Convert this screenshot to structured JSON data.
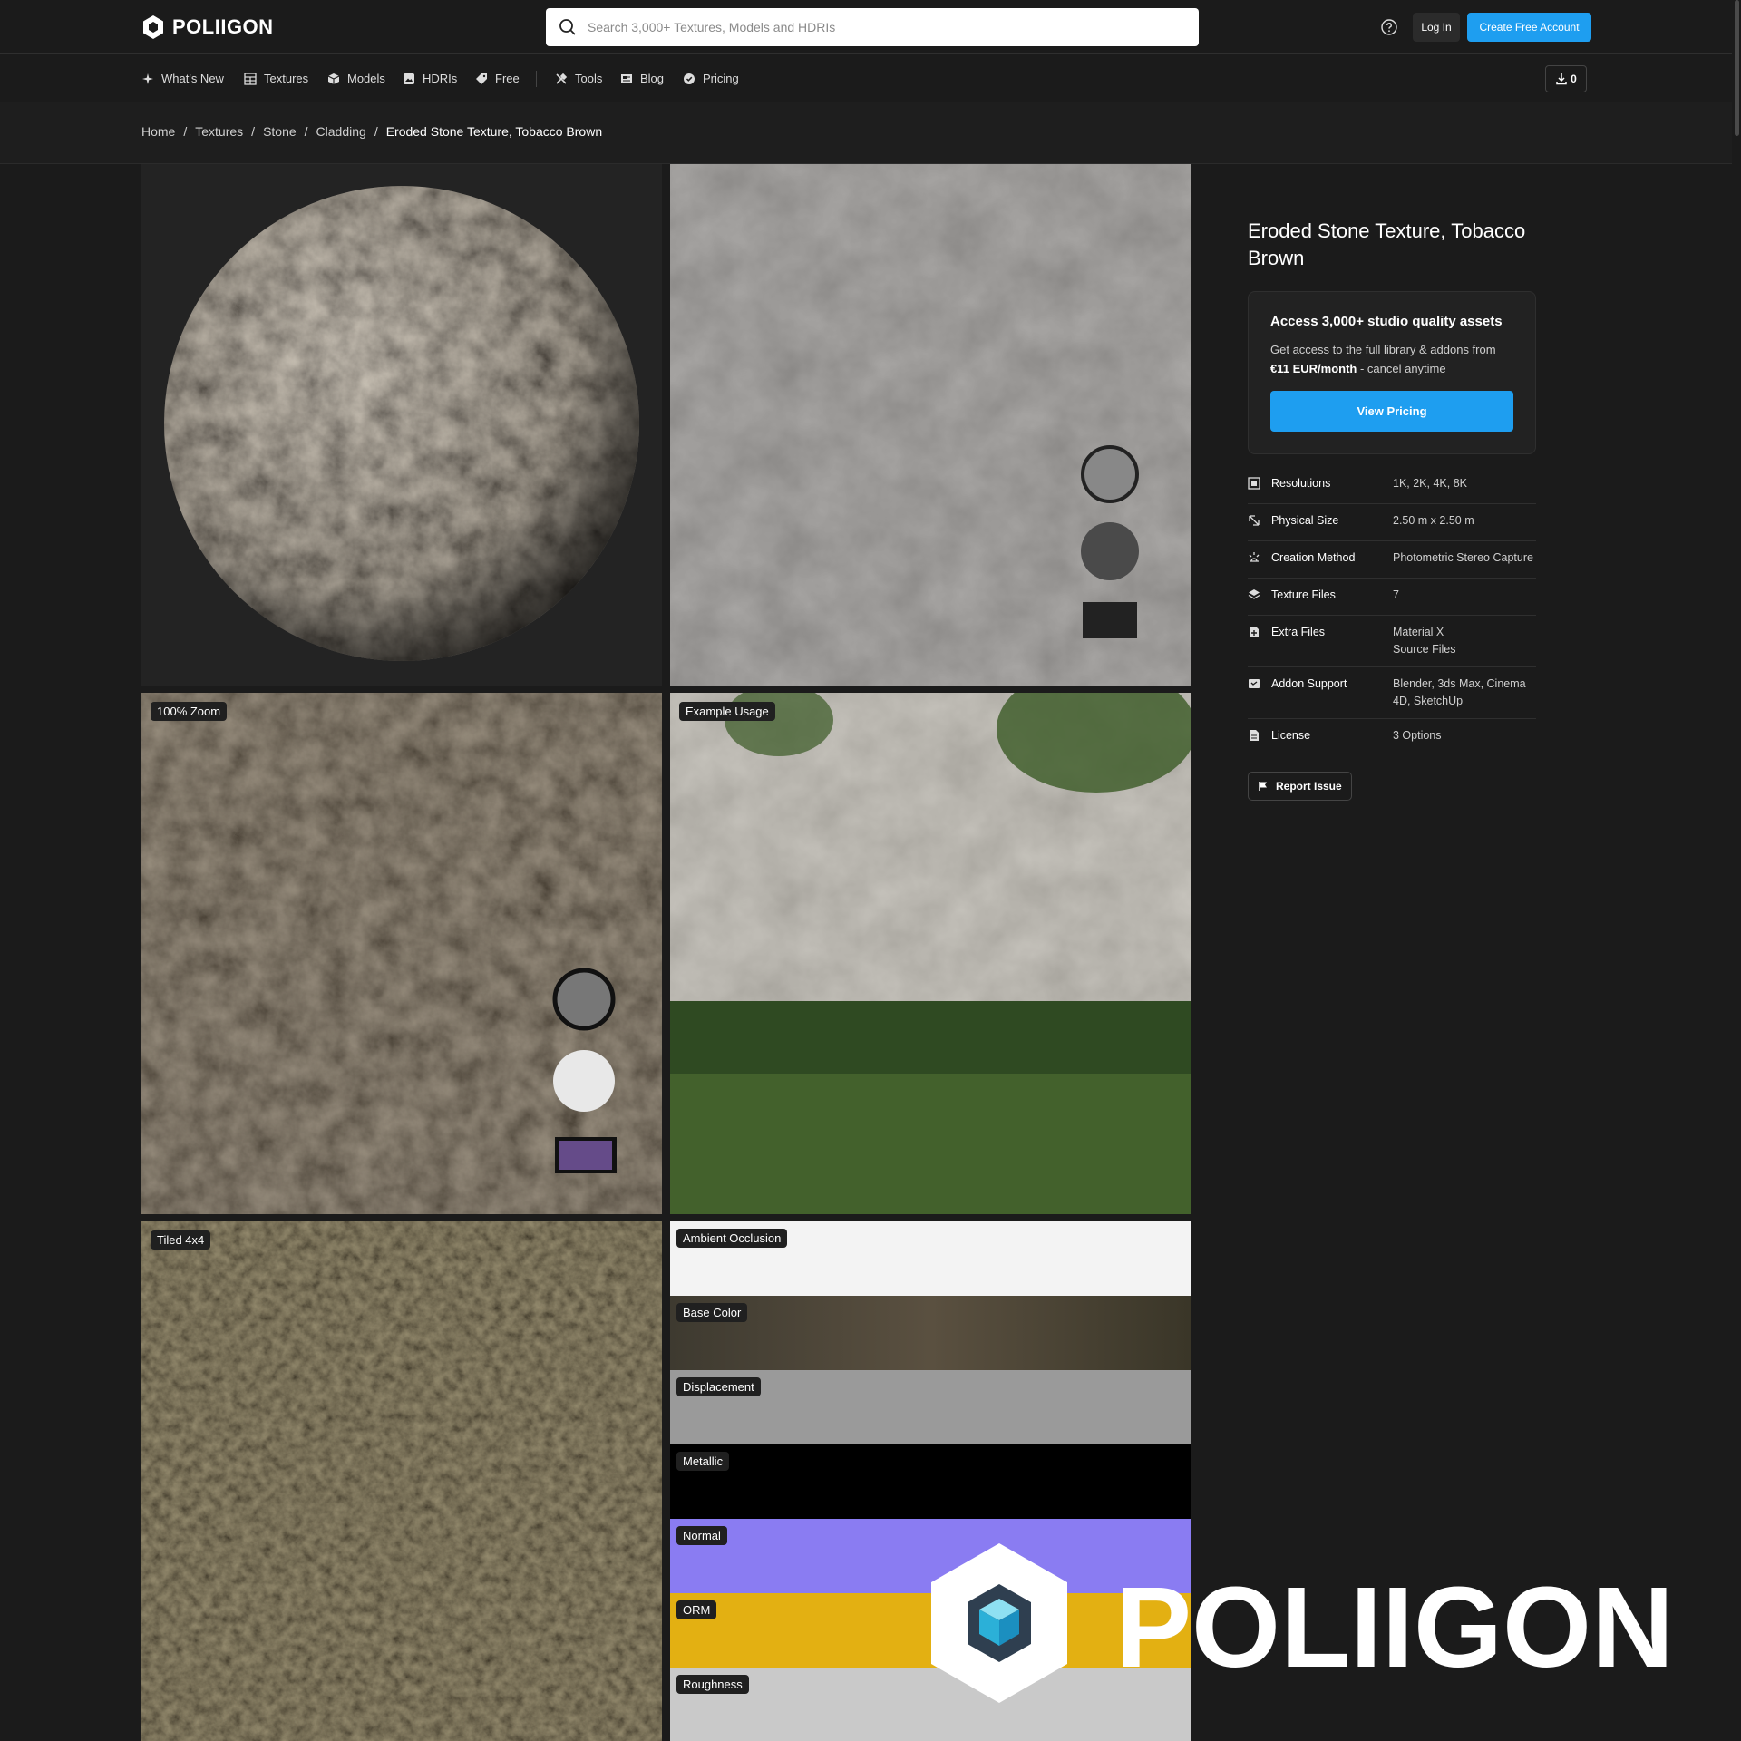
{
  "header": {
    "logo_text": "POLIIGON",
    "search_placeholder": "Search 3,000+ Textures, Models and HDRIs",
    "login_label": "Log In",
    "signup_label": "Create Free Account",
    "accent_color": "#1e9ef0"
  },
  "nav": {
    "items": [
      {
        "label": "What's New",
        "icon": "sparkle-icon"
      },
      {
        "label": "Textures",
        "icon": "grid-icon"
      },
      {
        "label": "Models",
        "icon": "cube-icon"
      },
      {
        "label": "HDRIs",
        "icon": "image-icon"
      },
      {
        "label": "Free",
        "icon": "tag-icon"
      },
      {
        "label": "Tools",
        "icon": "tools-icon"
      },
      {
        "label": "Blog",
        "icon": "newspaper-icon"
      },
      {
        "label": "Pricing",
        "icon": "badge-icon"
      }
    ],
    "download_count": "0"
  },
  "breadcrumb": {
    "items": [
      "Home",
      "Textures",
      "Stone",
      "Cladding"
    ],
    "current": "Eroded Stone Texture, Tobacco Brown",
    "separator": "/"
  },
  "gallery": {
    "zoom_label": "100% Zoom",
    "usage_label": "Example Usage",
    "tiled_label": "Tiled 4x4",
    "maps": [
      "Ambient Occlusion",
      "Base Color",
      "Displacement",
      "Metallic",
      "Normal",
      "ORM",
      "Roughness"
    ]
  },
  "asset": {
    "title": "Eroded Stone Texture, Tobacco Brown",
    "promo_title": "Access 3,000+ studio quality assets",
    "promo_text": "Get access to the full library & addons from",
    "promo_price": "€11 EUR/month",
    "promo_suffix": " - cancel anytime",
    "pricing_button": "View Pricing",
    "specs": [
      {
        "key": "Resolutions",
        "value": "1K, 2K, 4K, 8K",
        "icon": "resolution-icon"
      },
      {
        "key": "Physical Size",
        "value": "2.50 m x 2.50 m",
        "icon": "resize-icon"
      },
      {
        "key": "Creation Method",
        "value": "Photometric Stereo Capture",
        "icon": "capture-icon"
      },
      {
        "key": "Texture Files",
        "value": "7",
        "icon": "layers-icon"
      },
      {
        "key": "Extra Files",
        "value": "Material X\nSource Files",
        "icon": "file-plus-icon"
      },
      {
        "key": "Addon Support",
        "value": "Blender, 3ds Max, Cinema 4D, SketchUp",
        "icon": "addon-icon"
      },
      {
        "key": "License",
        "value": "3 Options",
        "icon": "license-icon"
      }
    ],
    "report_label": "Report Issue"
  },
  "watermark_text": "POLIIGON"
}
